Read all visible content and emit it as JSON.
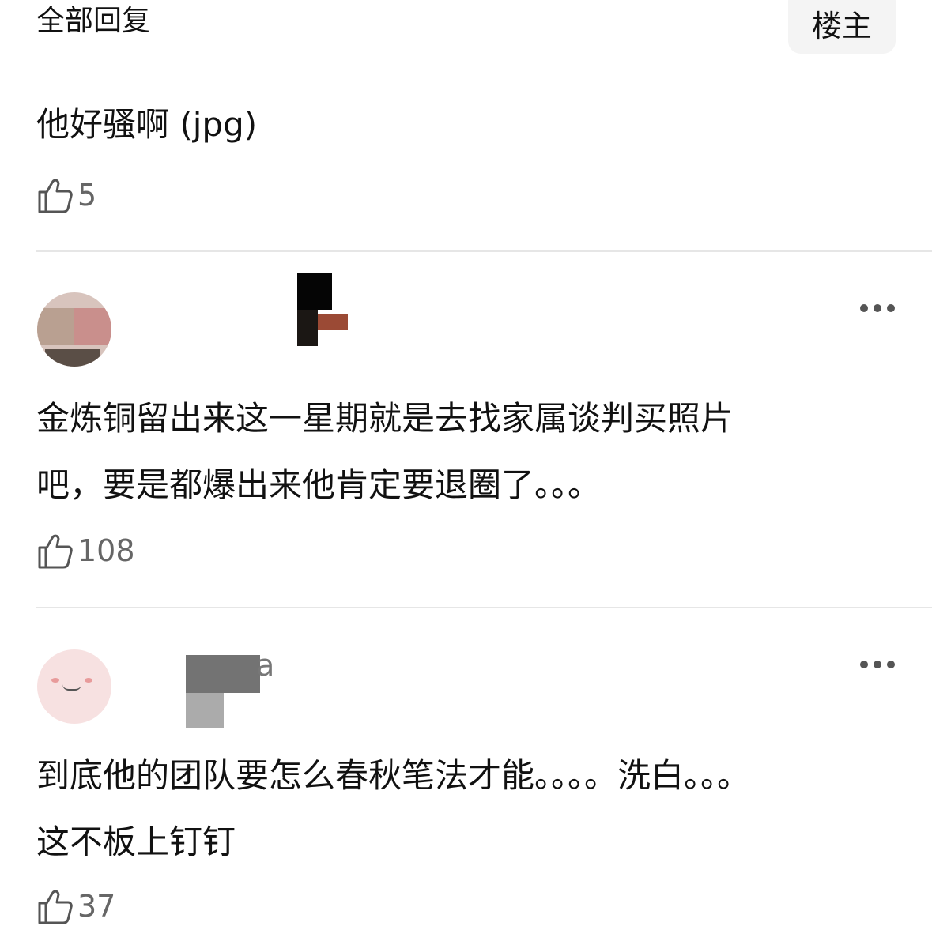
{
  "header": {
    "title": "全部回复",
    "op_button": "楼主"
  },
  "posts": [
    {
      "lines": [
        "他好骚啊 (jpg)"
      ],
      "likes": "5"
    },
    {
      "lines": [
        "金炼铜留出来这一星期就是去找家属谈判买照片",
        "吧，要是都爆出来他肯定要退圈了。。。"
      ],
      "likes": "108"
    },
    {
      "name_fragment": "a",
      "lines": [
        "到底他的团队要怎么春秋笔法才能。。。。洗白。。。",
        "这不板上钉钉"
      ],
      "likes": "37"
    }
  ],
  "icons": {
    "like": "thumbs-up-icon",
    "more": "more-dots-icon"
  },
  "colors": {
    "text": "#111111",
    "meta": "#666666",
    "divider": "#e6e6e6",
    "op_bg": "#f4f4f4"
  }
}
